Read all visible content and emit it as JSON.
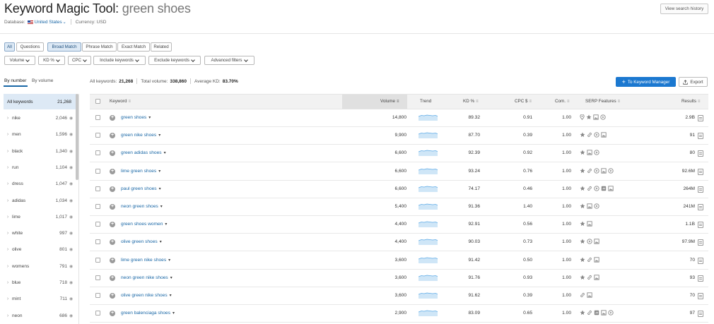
{
  "header": {
    "title_prefix": "Keyword Magic Tool:",
    "query": "green shoes",
    "history_button": "View search history",
    "database_label": "Database:",
    "database_value": "United States",
    "currency_label": "Currency: USD"
  },
  "match_tabs": [
    {
      "label": "All",
      "active": true
    },
    {
      "label": "Questions",
      "active": false
    },
    {
      "label": "Broad Match",
      "active": true
    },
    {
      "label": "Phrase Match",
      "active": false
    },
    {
      "label": "Exact Match",
      "active": false
    },
    {
      "label": "Related",
      "active": false
    }
  ],
  "filters": [
    "Volume",
    "KD %",
    "CPC",
    "Include keywords",
    "Exclude keywords",
    "Advanced filters"
  ],
  "group_tabs": {
    "by_number": "By number",
    "by_volume": "By volume"
  },
  "stats": {
    "all_keywords_label": "All keywords:",
    "all_keywords_value": "21,268",
    "total_volume_label": "Total volume:",
    "total_volume_value": "338,860",
    "avg_kd_label": "Average KD:",
    "avg_kd_value": "83.70%"
  },
  "actions": {
    "keyword_manager": "To Keyword Manager",
    "export": "Export"
  },
  "sidebar": {
    "all_label": "All keywords",
    "all_count": "21,268",
    "groups": [
      {
        "label": "nike",
        "count": "2,046"
      },
      {
        "label": "men",
        "count": "1,596"
      },
      {
        "label": "black",
        "count": "1,340"
      },
      {
        "label": "run",
        "count": "1,104"
      },
      {
        "label": "dress",
        "count": "1,047"
      },
      {
        "label": "adidas",
        "count": "1,034"
      },
      {
        "label": "lime",
        "count": "1,017"
      },
      {
        "label": "white",
        "count": "997"
      },
      {
        "label": "olive",
        "count": "801"
      },
      {
        "label": "womens",
        "count": "791"
      },
      {
        "label": "blue",
        "count": "718"
      },
      {
        "label": "mint",
        "count": "711"
      },
      {
        "label": "neon",
        "count": "686"
      }
    ]
  },
  "columns": {
    "keyword": "Keyword",
    "volume": "Volume",
    "trend": "Trend",
    "kd": "KD %",
    "cpc": "CPC $",
    "com": "Com.",
    "serp": "SERP Features",
    "results": "Results"
  },
  "rows": [
    {
      "keyword": "green shoes",
      "volume": "14,800",
      "kd": "89.32",
      "cpc": "0.91",
      "com": "1.00",
      "serp": [
        "pin",
        "star",
        "image",
        "video"
      ],
      "results": "2.9B"
    },
    {
      "keyword": "green nike shoes",
      "volume": "9,900",
      "kd": "87.70",
      "cpc": "0.39",
      "com": "1.00",
      "serp": [
        "star",
        "link",
        "video",
        "image"
      ],
      "results": "91"
    },
    {
      "keyword": "green adidas shoes",
      "volume": "6,600",
      "kd": "92.39",
      "cpc": "0.92",
      "com": "1.00",
      "serp": [
        "star",
        "image",
        "video"
      ],
      "results": "80"
    },
    {
      "keyword": "lime green shoes",
      "volume": "6,600",
      "kd": "93.24",
      "cpc": "0.76",
      "com": "1.00",
      "serp": [
        "star",
        "link",
        "video",
        "image",
        "video"
      ],
      "results": "92.6M"
    },
    {
      "keyword": "paul green shoes",
      "volume": "6,600",
      "kd": "74.17",
      "cpc": "0.46",
      "com": "1.00",
      "serp": [
        "star",
        "link",
        "video",
        "quote",
        "image"
      ],
      "results": "264M"
    },
    {
      "keyword": "neon green shoes",
      "volume": "5,400",
      "kd": "91.36",
      "cpc": "1.40",
      "com": "1.00",
      "serp": [
        "star",
        "image",
        "video"
      ],
      "results": "241M"
    },
    {
      "keyword": "green shoes women",
      "volume": "4,400",
      "kd": "92.91",
      "cpc": "0.56",
      "com": "1.00",
      "serp": [
        "star",
        "image"
      ],
      "results": "1.1B"
    },
    {
      "keyword": "olive green shoes",
      "volume": "4,400",
      "kd": "90.03",
      "cpc": "0.73",
      "com": "1.00",
      "serp": [
        "star",
        "video",
        "image"
      ],
      "results": "97.9M"
    },
    {
      "keyword": "lime green nike shoes",
      "volume": "3,600",
      "kd": "91.42",
      "cpc": "0.50",
      "com": "1.00",
      "serp": [
        "star",
        "link",
        "image"
      ],
      "results": "70"
    },
    {
      "keyword": "neon green nike shoes",
      "volume": "3,600",
      "kd": "91.76",
      "cpc": "0.93",
      "com": "1.00",
      "serp": [
        "star",
        "link",
        "image"
      ],
      "results": "93"
    },
    {
      "keyword": "olive green nike shoes",
      "volume": "3,600",
      "kd": "91.62",
      "cpc": "0.39",
      "com": "1.00",
      "serp": [
        "link",
        "image"
      ],
      "results": "70"
    },
    {
      "keyword": "green balenciaga shoes",
      "volume": "2,900",
      "kd": "83.09",
      "cpc": "0.65",
      "com": "1.00",
      "serp": [
        "star",
        "link",
        "quote",
        "image",
        "video"
      ],
      "results": "97"
    }
  ],
  "colors": {
    "link": "#1967a6",
    "accent": "#1b78d0",
    "active_bg": "#dde9f5",
    "trend": "#5aa9e6"
  }
}
